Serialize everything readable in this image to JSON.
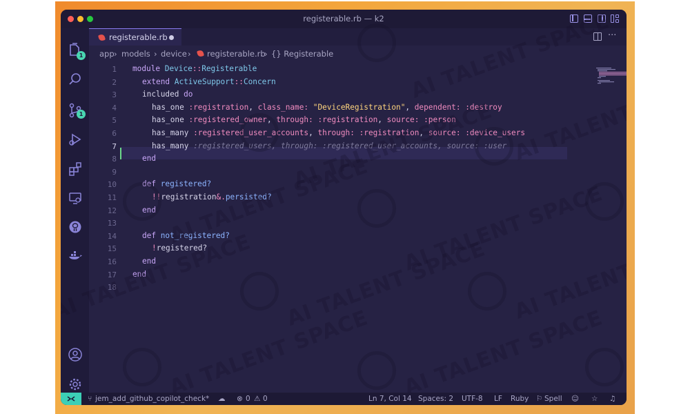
{
  "window": {
    "title": "registerable.rb — k2",
    "accent_color": "#8a7cf0"
  },
  "activity_bar": {
    "explorer_badge": "1",
    "scm_badge": "1"
  },
  "tab": {
    "label": "registerable.rb"
  },
  "breadcrumb": {
    "items": [
      "app",
      "models",
      "device",
      "registerable.rb",
      "{} Registerable"
    ]
  },
  "editor": {
    "line_numbers": [
      "1",
      "2",
      "3",
      "4",
      "5",
      "6",
      "7",
      "8",
      "9",
      "10",
      "11",
      "12",
      "13",
      "14",
      "15",
      "16",
      "17",
      "18"
    ],
    "current_line": "7",
    "code": {
      "l1": [
        "module ",
        "Device",
        "::",
        "Registerable"
      ],
      "l2": [
        "extend ",
        "ActiveSupport",
        "::",
        "Concern"
      ],
      "l3": [
        "included ",
        "do"
      ],
      "l4": [
        "has_one ",
        ":registration",
        ", ",
        "class_name:",
        " ",
        "\"DeviceRegistration\"",
        ", ",
        "dependent:",
        " ",
        ":destroy"
      ],
      "l5": [
        "has_one ",
        ":registered_owner",
        ", ",
        "through:",
        " ",
        ":registration",
        ", ",
        "source:",
        " ",
        ":person"
      ],
      "l6": [
        "has_many ",
        ":registered_user_accounts",
        ", ",
        "through:",
        " ",
        ":registration",
        ", ",
        "source:",
        " ",
        ":device_users"
      ],
      "l7": [
        "has_many ",
        ":registered_users, through: :registered_user_accounts, source: :user"
      ],
      "l8": [
        "end"
      ],
      "l10": [
        "def ",
        "registered?"
      ],
      "l11": [
        "!!",
        "registration",
        "&.",
        "persisted?"
      ],
      "l12": [
        "end"
      ],
      "l14": [
        "def ",
        "not_registered?"
      ],
      "l15": [
        "!",
        "registered?"
      ],
      "l16": [
        "end"
      ],
      "l17": [
        "end"
      ]
    }
  },
  "statusbar": {
    "branch": "jem_add_github_copilot_check*",
    "errors": "0",
    "warnings": "0",
    "position": "Ln 7, Col 14",
    "spaces": "Spaces: 2",
    "encoding": "UTF-8",
    "eol": "LF",
    "language": "Ruby",
    "spell": "Spell",
    "remote_color": "#3ccfb6"
  },
  "watermark": {
    "text": "AI TALENT SPACE"
  }
}
